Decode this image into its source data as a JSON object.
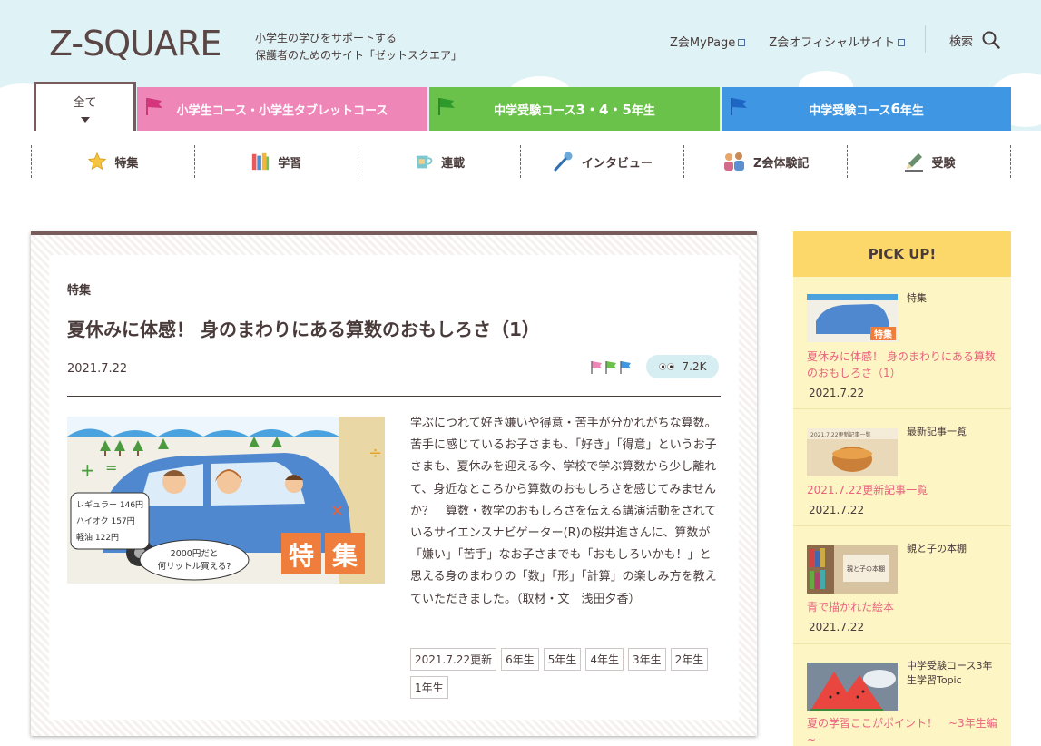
{
  "header": {
    "logo": "Z-SQUARE",
    "tagline_1": "小学生の学びをサポートする",
    "tagline_2": "保護者のためのサイト「ゼットスクエア」",
    "link_mypage": "Z会MyPage",
    "link_official": "Z会オフィシャルサイト",
    "search_label": "検索"
  },
  "course_tabs": {
    "all": "全て",
    "elementary": "小学生コース・小学生タブレットコース",
    "exam_345_a": "中学受験コース ",
    "exam_345_b": "3・4・5",
    "exam_345_c": "年生",
    "exam_6_a": "中学受験コース ",
    "exam_6_b": "6",
    "exam_6_c": "年生"
  },
  "categories": [
    {
      "label": "特集",
      "icon": "star-icon"
    },
    {
      "label": "学習",
      "icon": "books-icon"
    },
    {
      "label": "連載",
      "icon": "cup-icon"
    },
    {
      "label": "インタビュー",
      "icon": "microphone-icon"
    },
    {
      "label": "Z会体験記",
      "icon": "people-icon"
    },
    {
      "label": "受験",
      "icon": "pencil-icon"
    }
  ],
  "article": {
    "category": "特集",
    "title": "夏休みに体感！ 身のまわりにある算数のおもしろさ（1）",
    "date": "2021.7.22",
    "views": "7.2K",
    "image_label": "特集",
    "image_text_1": "レギュラー 146円",
    "image_text_2": "ハイオク 157円",
    "image_text_3": "軽油 122円",
    "image_text_4": "2000円だと",
    "image_text_5": "何リットル買える?",
    "body": "学ぶにつれて好き嫌いや得意・苦手が分かれがちな算数。苦手に感じているお子さまも、「好き」「得意」というお子さまも、夏休みを迎える今、学校で学ぶ算数から少し離れて、身近なところから算数のおもしろさを感じてみませんか？　算数・数学のおもしろさを伝える講演活動をされているサイエンスナビゲーター(R)の桜井進さんに、算数が「嫌い」「苦手」なお子さまでも「おもしろいかも！」と思える身のまわりの「数」「形」「計算」の楽しみ方を教えていただきました。（取材・文　浅田夕香）",
    "tags": [
      "2021.7.22更新",
      "6年生",
      "5年生",
      "4年生",
      "3年生",
      "2年生",
      "1年生"
    ]
  },
  "pickup": {
    "heading": "PICK UP!",
    "items": [
      {
        "category": "特集",
        "title": "夏休みに体感！ 身のまわりにある算数のおもしろさ（1）",
        "date": "2021.7.22"
      },
      {
        "category": "最新記事一覧",
        "title": "2021.7.22更新記事一覧",
        "date": "2021.7.22",
        "thumb_text": "2021.7.22更新記事一覧"
      },
      {
        "category": "親と子の本棚",
        "title": "青で描かれた絵本",
        "date": "2021.7.22",
        "thumb_text": "親と子の本棚"
      },
      {
        "category": "中学受験コース3年生学習Topic",
        "title": "夏の学習ここがポイント！　~3年生編~",
        "date": ""
      }
    ]
  },
  "colors": {
    "brand_brown": "#7a5b5b",
    "pink": "#ef86b8",
    "green": "#6bc24b",
    "blue": "#3f96e2",
    "pickup_bg": "#fdf5c4",
    "pickup_head": "#fcd86a",
    "link_pink": "#e8637e"
  }
}
